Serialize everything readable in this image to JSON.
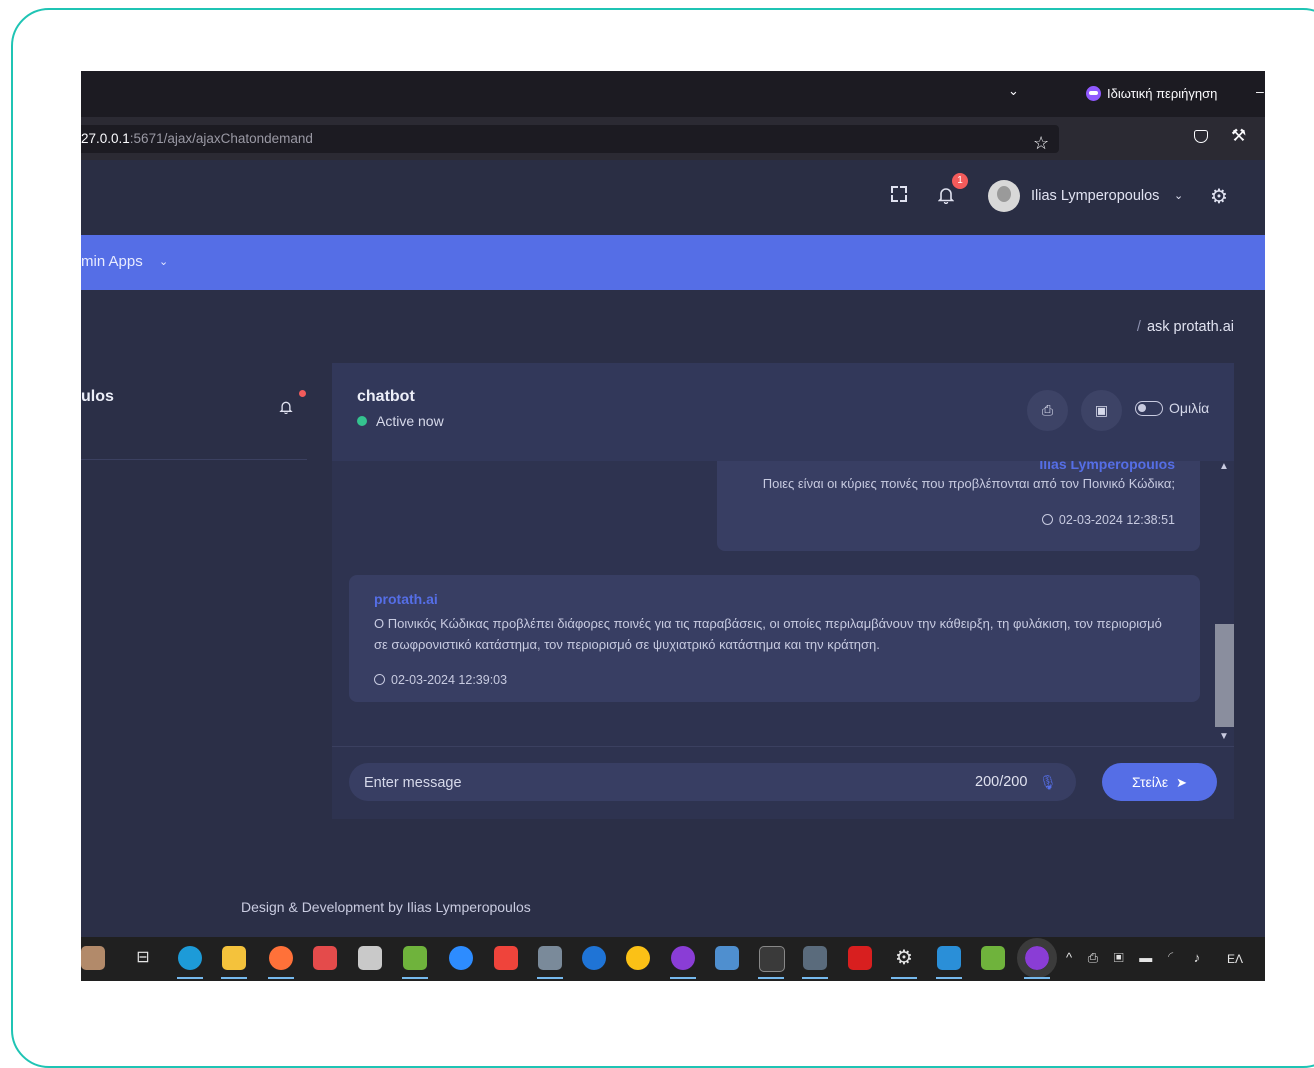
{
  "browser": {
    "url_host": "27.0.0.1",
    "url_path": ":5671/ajax/ajaxChatondemand",
    "private_label": "Ιδιωτική περιήγηση"
  },
  "header": {
    "notification_count": "1",
    "user_name": "Ilias Lymperopoulos"
  },
  "nav": {
    "item_label": "min Apps"
  },
  "breadcrumb": {
    "current": "ask protath.ai"
  },
  "sidebar": {
    "user_name_fragment": "ulos"
  },
  "chat": {
    "title": "chatbot",
    "status": "Active now",
    "toggle_label": "Ομιλία",
    "messages": [
      {
        "sender": "Ilias Lymperopoulos",
        "text": "Ποιες είναι οι κύριες ποινές που προβλέπονται από τον Ποινικό Κώδικα;",
        "time": "02-03-2024 12:38:51"
      },
      {
        "sender": "protath.ai",
        "text": "Ο Ποινικός Κώδικας προβλέπει διάφορες ποινές για τις παραβάσεις, οι οποίες περιλαμβάνουν την κάθειρξη, τη φυλάκιση, τον περιορισμό σε σωφρονιστικό κατάστημα, τον περιορισμό σε ψυχιατρικό κατάστημα και την κράτηση.",
        "time": "02-03-2024 12:39:03"
      }
    ],
    "input_placeholder": "Enter message",
    "char_counter": "200/200",
    "send_label": "Στείλε"
  },
  "footer": {
    "text": "Design & Development by Ilias Lymperopoulos"
  },
  "taskbar": {
    "language": "ΕΛ",
    "apps": [
      "edge-icon",
      "file-explorer-icon",
      "firefox-icon",
      "paint-icon",
      "tex-icon",
      "notepad-icon",
      "zoom-icon",
      "anydesk-icon",
      "archive-icon",
      "thunderbird-icon",
      "chrome-icon",
      "firefox-private-icon",
      "notes-icon",
      "terminal-icon",
      "calculator-icon",
      "acrobat-icon",
      "settings-icon",
      "outlook-icon",
      "image-editor-icon",
      "firefox-private-active-icon"
    ]
  },
  "colors": {
    "accent": "#556ee6",
    "frame": "#1fc4b4",
    "online": "#34c38f",
    "badge": "#f35b5b"
  }
}
